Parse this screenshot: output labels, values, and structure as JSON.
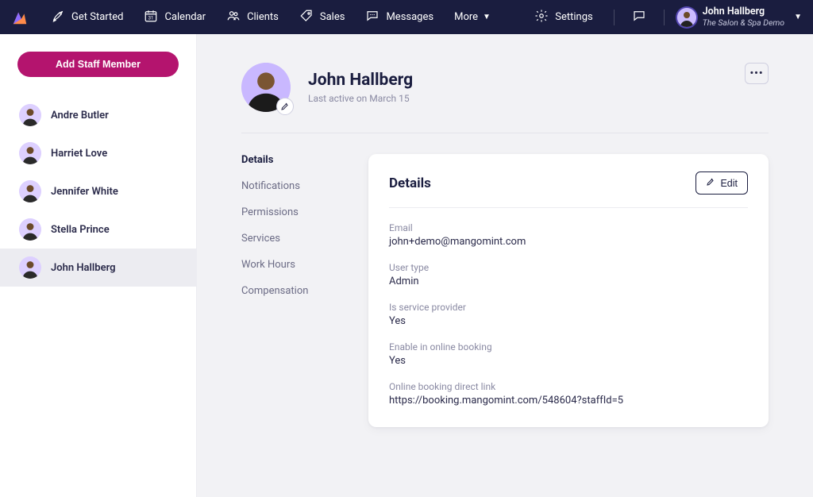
{
  "nav": {
    "items": [
      {
        "icon": "rocket",
        "label": "Get Started"
      },
      {
        "icon": "calendar",
        "label": "Calendar"
      },
      {
        "icon": "clients",
        "label": "Clients"
      },
      {
        "icon": "tag",
        "label": "Sales"
      },
      {
        "icon": "chat",
        "label": "Messages"
      }
    ],
    "more": "More",
    "settings": "Settings",
    "user": {
      "name": "John Hallberg",
      "subtitle": "The Salon & Spa Demo"
    }
  },
  "sidebar": {
    "add_button": "Add Staff Member",
    "staff": [
      {
        "name": "Andre Butler",
        "active": false
      },
      {
        "name": "Harriet Love",
        "active": false
      },
      {
        "name": "Jennifer White",
        "active": false
      },
      {
        "name": "Stella Prince",
        "active": false
      },
      {
        "name": "John Hallberg",
        "active": true
      }
    ]
  },
  "profile": {
    "name": "John Hallberg",
    "last_active": "Last active on March 15"
  },
  "sections": [
    {
      "label": "Details",
      "active": true
    },
    {
      "label": "Notifications",
      "active": false
    },
    {
      "label": "Permissions",
      "active": false
    },
    {
      "label": "Services",
      "active": false
    },
    {
      "label": "Work Hours",
      "active": false
    },
    {
      "label": "Compensation",
      "active": false
    }
  ],
  "details_card": {
    "title": "Details",
    "edit_label": "Edit",
    "fields": [
      {
        "label": "Email",
        "value": "john+demo@mangomint.com"
      },
      {
        "label": "User type",
        "value": "Admin"
      },
      {
        "label": "Is service provider",
        "value": "Yes"
      },
      {
        "label": "Enable in online booking",
        "value": "Yes"
      },
      {
        "label": "Online booking direct link",
        "value": "https://booking.mangomint.com/548604?staffId=5"
      }
    ]
  }
}
